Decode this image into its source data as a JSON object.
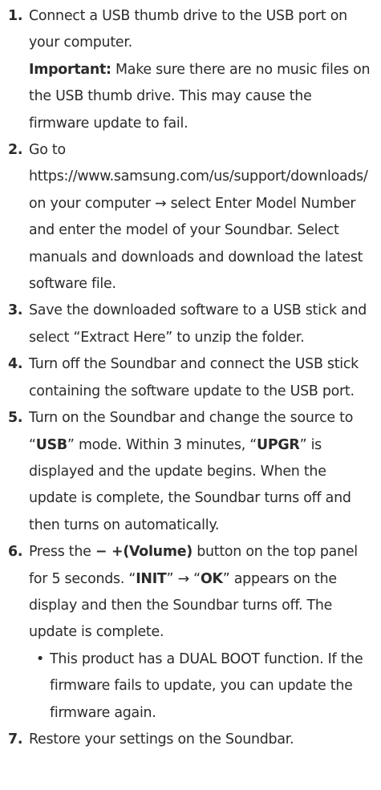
{
  "steps": {
    "s1": {
      "num": "1.",
      "text": "Connect a USB thumb drive to the USB port on your computer.",
      "important_label": "Important:",
      "important_text": " Make sure there are no music files on the USB thumb drive. This may cause the firmware update to fail."
    },
    "s2": {
      "num": "2.",
      "text": "Go to https://www.samsung.com/us/support/downloads/ on your computer → select Enter Model Number and enter the model of your Soundbar. Select manuals and downloads and download the latest software file."
    },
    "s3": {
      "num": "3.",
      "text": "Save the downloaded software to a USB stick and select “Extract Here” to unzip the folder."
    },
    "s4": {
      "num": "4.",
      "text": "Turn off the Soundbar and connect the USB stick containing the software update to the USB port."
    },
    "s5": {
      "num": "5.",
      "a": "Turn on the Soundbar and change the source to “",
      "usb": "USB",
      "b": "” mode. Within 3 minutes, “",
      "upgr": "UPGR",
      "c": "” is displayed and the update begins. When the update is complete, the Soundbar turns off and then turns on automatically."
    },
    "s6": {
      "num": "6.",
      "a": "Press the ",
      "volume": "− +(Volume)",
      "b": " button on the top panel for 5 seconds. “",
      "init": "INIT",
      "c": "” → “",
      "ok": "OK",
      "d": "” appears on the display and then the Soundbar turns off. The update is complete.",
      "bullet": "This product has a DUAL BOOT function. If the firmware fails to update, you can update the firmware again."
    },
    "s7": {
      "num": "7.",
      "text": "Restore your settings on the Soundbar."
    }
  }
}
